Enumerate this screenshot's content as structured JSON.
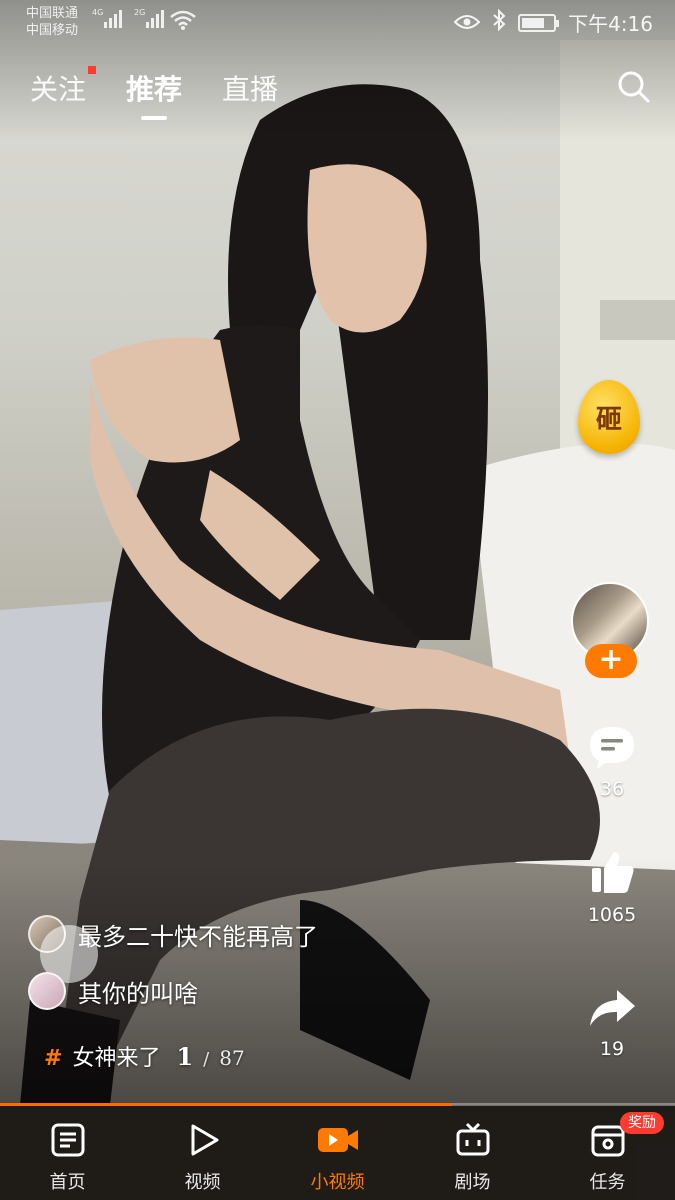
{
  "status_bar": {
    "carrier_1": "中国联通",
    "carrier_2": "中国移动",
    "net_1": "4G",
    "net_2": "2G",
    "time": "下午4:16"
  },
  "top_tabs": [
    {
      "label": "关注",
      "has_dot": true
    },
    {
      "label": "推荐",
      "active": true
    },
    {
      "label": "直播"
    }
  ],
  "egg": {
    "label": "砸"
  },
  "actions": {
    "comment_count": "36",
    "like_count": "1065",
    "share_count": "19"
  },
  "bullets": [
    {
      "text": "最多二十快不能再高了"
    },
    {
      "text": "其你的叫啥"
    }
  ],
  "topic": {
    "name": "女神来了",
    "current": "1",
    "separator": "/",
    "total": "87"
  },
  "progress": {
    "fraction": 0.67
  },
  "bottom_nav": [
    {
      "label": "首页",
      "icon": "home-doc-icon"
    },
    {
      "label": "视频",
      "icon": "play-icon"
    },
    {
      "label": "小视频",
      "icon": "short-video-icon",
      "active": true
    },
    {
      "label": "剧场",
      "icon": "tv-icon"
    },
    {
      "label": "任务",
      "icon": "task-icon",
      "badge": "奖励"
    }
  ],
  "colors": {
    "accent": "#ff7a00",
    "dot": "#ff3b30",
    "egg": "#f5b300"
  }
}
